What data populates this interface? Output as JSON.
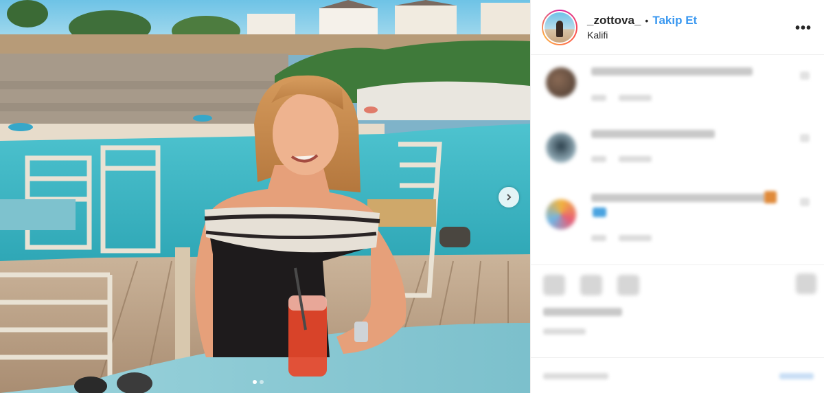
{
  "post": {
    "username": "_zottova_",
    "separator": "•",
    "follow_label": "Takip Et",
    "location": "Kalifi",
    "more_label": "•••"
  },
  "carousel": {
    "slide_count": 2,
    "active_slide": 1
  },
  "icons": {
    "next": "chevron-right-icon",
    "more": "more-options-icon"
  },
  "colors": {
    "link_blue": "#3897f0",
    "text": "#262626",
    "border": "#efefef"
  }
}
